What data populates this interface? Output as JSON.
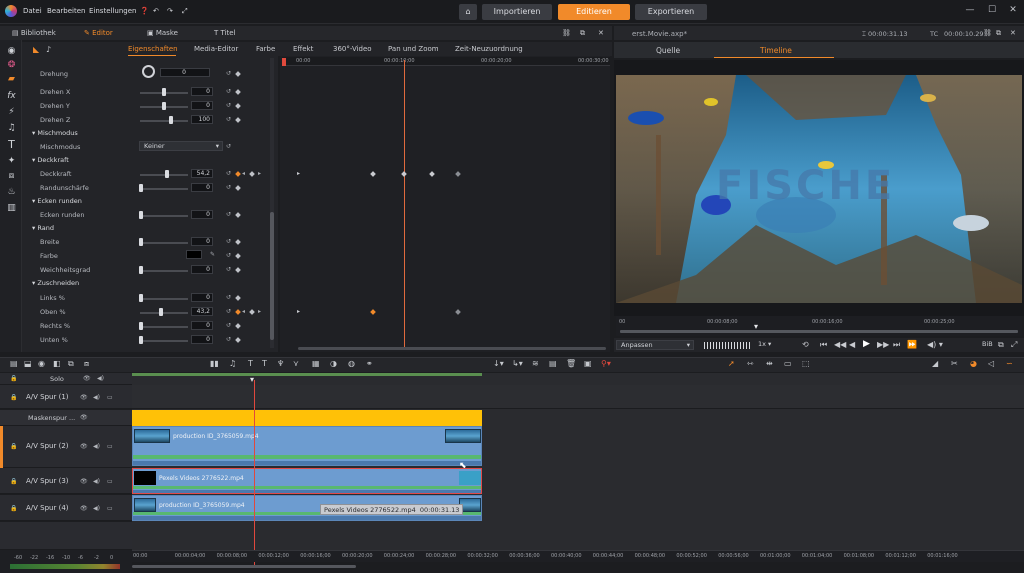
{
  "menu": {
    "file": "Datei",
    "edit": "Bearbeiten",
    "settings": "Einstellungen",
    "help_icon": "help-icon"
  },
  "modes": {
    "import": "Importieren",
    "edit": "Editieren",
    "export": "Exportieren"
  },
  "tabs": {
    "library": "Bibliothek",
    "editor": "Editor",
    "mask": "Maske",
    "title": "Titel"
  },
  "subtabs": [
    "Eigenschaften",
    "Media-Editor",
    "Farbe",
    "Effekt",
    "360°-Video",
    "Pan und Zoom",
    "Zeit-Neuzuordnung"
  ],
  "properties": {
    "rotation": {
      "label": "Drehung",
      "value": "0"
    },
    "rotate_x": {
      "label": "Drehen X",
      "value": "0"
    },
    "rotate_y": {
      "label": "Drehen Y",
      "value": "0"
    },
    "rotate_z": {
      "label": "Drehen Z",
      "value": "100"
    },
    "blend_section": "Mischmodus",
    "blend_label": "Mischmodus",
    "blend_value": "Keiner",
    "opacity_section": "Deckkraft",
    "opacity": {
      "label": "Deckkraft",
      "value": "54,2"
    },
    "edge_softness": {
      "label": "Randunschärfe",
      "value": "0"
    },
    "corners_section": "Ecken runden",
    "corners": {
      "label": "Ecken runden",
      "value": "0"
    },
    "border_section": "Rand",
    "width": {
      "label": "Breite",
      "value": "0"
    },
    "color_label": "Farbe",
    "feather": {
      "label": "Weichheitsgrad",
      "value": "0"
    },
    "crop_section": "Zuschneiden",
    "left": {
      "label": "Links %",
      "value": "0"
    },
    "top": {
      "label": "Oben %",
      "value": "43,2"
    },
    "right": {
      "label": "Rechts %",
      "value": "0"
    },
    "bottom": {
      "label": "Unten %",
      "value": "0"
    }
  },
  "kf_ruler": [
    "00:00",
    "00:00:10;00",
    "00:00:20;00",
    "00:00:30;00"
  ],
  "preview": {
    "filename": "erst.Movie.axp*",
    "timecode_a": "00:00:31.13",
    "tc_label": "TC",
    "timecode_b": "00:00:10.29",
    "tab_source": "Quelle",
    "tab_timeline": "Timeline",
    "ruler": [
      "00",
      "00:00:08;00",
      "00:00:16;00",
      "00:00:25;00"
    ],
    "fit": "Anpassen",
    "speed": "1x",
    "overlay_text": "FISCHE"
  },
  "tracks": {
    "solo": "Solo",
    "t1": "A/V Spur (1)",
    "mask": "Maskenspur ...",
    "t2": "A/V Spur (2)",
    "t3": "A/V Spur (3)",
    "t4": "A/V Spur (4)"
  },
  "clips": {
    "c2": "production ID_3765059.mp4",
    "c3": "Pexels Videos 2776522.mp4",
    "c4": "production ID_3765059.mp4",
    "tooltip_name": "Pexels Videos 2776522.mp4",
    "tooltip_time": "00:00:31.13"
  },
  "timeline_ruler": [
    "00:00",
    "00:00:04;00",
    "00:00:08;00",
    "00:00:12;00",
    "00:00:16;00",
    "00:00:20;00",
    "00:00:24;00",
    "00:00:28;00",
    "00:00:32;00",
    "00:00:36;00",
    "00:00:40;00",
    "00:00:44;00",
    "00:00:48;00",
    "00:00:52;00",
    "00:00:56;00",
    "00:01:00;00",
    "00:01:04;00",
    "00:01:08;00",
    "00:01:12;00",
    "00:01:16;00"
  ],
  "meter_scale": [
    "-60",
    "-22",
    "-16",
    "-10",
    "-6",
    "-2",
    "0"
  ],
  "colors": {
    "accent": "#f18a2a",
    "mask_track": "#ffc107",
    "clip": "#6d9cd0",
    "playhead": "#e0483d"
  }
}
